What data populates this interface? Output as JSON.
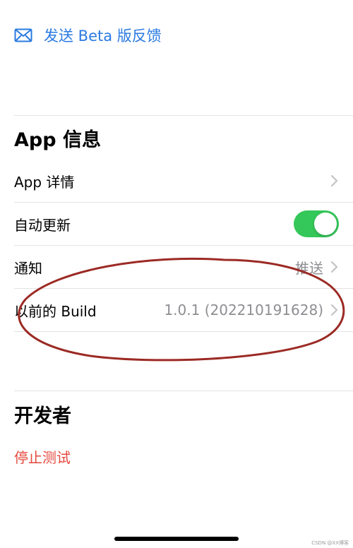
{
  "feedback": {
    "label": "发送 Beta 版反馈",
    "icon": "envelope-icon"
  },
  "app_info": {
    "title": "App 信息",
    "rows": [
      {
        "label": "App 详情",
        "value": ""
      },
      {
        "label": "自动更新",
        "toggle_on": true
      },
      {
        "label": "通知",
        "value": "推送"
      },
      {
        "label": "以前的 Build",
        "value": "1.0.1 (202210191628)"
      }
    ]
  },
  "developer": {
    "title": "开发者",
    "stop_testing": "停止测试"
  },
  "colors": {
    "link_blue": "#2a7ae2",
    "toggle_green": "#34c759",
    "destructive_red": "#e5483c",
    "annotation_red": "#9c2a24"
  },
  "watermark": "CSDN @XX博客"
}
